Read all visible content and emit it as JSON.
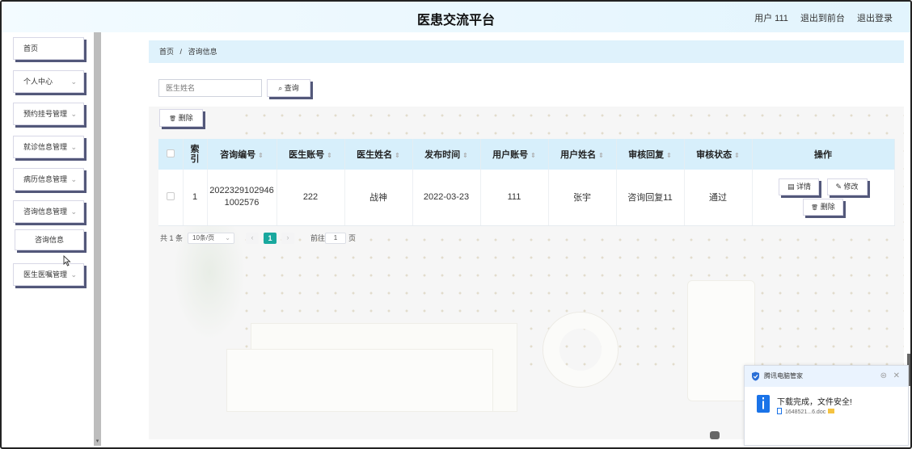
{
  "header": {
    "title": "医患交流平台",
    "user": "用户 111",
    "back_to_front": "退出到前台",
    "logout": "退出登录"
  },
  "sidebar": {
    "items": [
      {
        "label": "首页",
        "has_chevron": false
      },
      {
        "label": "个人中心",
        "has_chevron": true
      },
      {
        "label": "预约挂号管理",
        "has_chevron": true
      },
      {
        "label": "就诊信息管理",
        "has_chevron": true
      },
      {
        "label": "病历信息管理",
        "has_chevron": true
      },
      {
        "label": "咨询信息管理",
        "has_chevron": true,
        "expanded": true
      },
      {
        "label": "医生医嘱管理",
        "has_chevron": true
      }
    ],
    "subitems": [
      {
        "label": "咨询信息",
        "parent": "咨询信息管理",
        "active": true
      }
    ],
    "chevron_glyph": "⌄"
  },
  "breadcrumb": {
    "home": "首页",
    "separator": "/",
    "current": "咨询信息"
  },
  "search": {
    "placeholder": "医生姓名",
    "value": "",
    "button_label": "查询",
    "search_icon_glyph": "⌕"
  },
  "toolbar": {
    "delete_label": "删除",
    "delete_icon_glyph": "🗑"
  },
  "table": {
    "columns": [
      {
        "key": "checkbox",
        "label": ""
      },
      {
        "key": "index",
        "label": "索引"
      },
      {
        "key": "consult_no",
        "label": "咨询编号",
        "sortable": true
      },
      {
        "key": "doctor_account",
        "label": "医生账号",
        "sortable": true
      },
      {
        "key": "doctor_name",
        "label": "医生姓名",
        "sortable": true
      },
      {
        "key": "publish_time",
        "label": "发布时间",
        "sortable": true
      },
      {
        "key": "user_account",
        "label": "用户账号",
        "sortable": true
      },
      {
        "key": "user_name",
        "label": "用户姓名",
        "sortable": true
      },
      {
        "key": "review_reply",
        "label": "审核回复",
        "sortable": true
      },
      {
        "key": "review_status",
        "label": "审核状态",
        "sortable": true
      },
      {
        "key": "actions",
        "label": "操作"
      }
    ],
    "sort_glyph": "⇕",
    "rows": [
      {
        "index": "1",
        "consult_no": "2022329102946 1002576",
        "doctor_account": "222",
        "doctor_name": "战神",
        "publish_time": "2022-03-23",
        "user_account": "111",
        "user_name": "张宇",
        "review_reply": "咨询回复11",
        "review_status": "通过"
      }
    ],
    "row_actions": {
      "detail": "详情",
      "edit": "修改",
      "delete": "删除",
      "detail_icon_glyph": "▤",
      "edit_icon_glyph": "✎",
      "delete_icon_glyph": "🗑"
    }
  },
  "pagination": {
    "total": "共 1 条",
    "page_size": "10条/页",
    "page_size_chevron": "⌄",
    "prev_glyph": "‹",
    "next_glyph": "›",
    "current_page": "1",
    "goto_label": "前往",
    "goto_value": "1",
    "page_unit": "页"
  },
  "toast": {
    "app_name": "腾讯电脑管家",
    "message": "下载完成，文件安全!",
    "file_name": "1648521...6.doc",
    "gear_glyph": "⊜",
    "close_glyph": "✕"
  },
  "colors": {
    "accent": "#19a89e",
    "table_header_bg": "#d7effb",
    "breadcrumb_bg": "#dff2fc",
    "button_shadow": "#53587a",
    "toast_info_blue": "#1a73e8"
  }
}
